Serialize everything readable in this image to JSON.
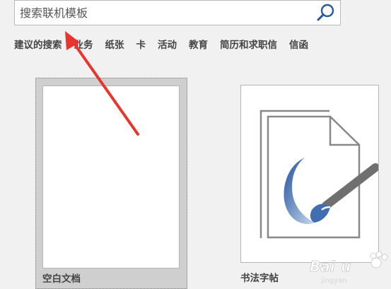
{
  "search": {
    "placeholder": "搜索联机模板"
  },
  "categories": [
    "建议的搜索",
    "业务",
    "纸张",
    "卡",
    "活动",
    "教育",
    "简历和求职信",
    "信函"
  ],
  "templates": [
    {
      "label": "空白文档"
    },
    {
      "label": "书法字帖"
    }
  ],
  "icons": {
    "search": "search-icon"
  },
  "colors": {
    "accent": "#2b579a",
    "arrow": "#e8352e"
  }
}
